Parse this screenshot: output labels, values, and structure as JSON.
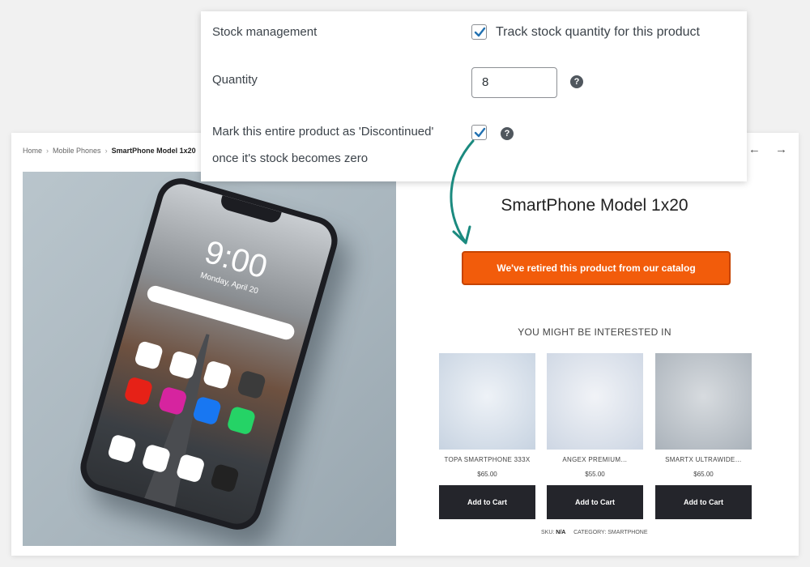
{
  "settings": {
    "stock_management_label": "Stock management",
    "track_stock_label": "Track stock quantity for this product",
    "track_stock_checked": true,
    "quantity_label": "Quantity",
    "quantity_value": "8",
    "discontinued_label_line1": "Mark this entire product as 'Discontinued'",
    "discontinued_label_line2": "once it's stock becomes zero",
    "discontinued_checked": true,
    "help_glyph": "?"
  },
  "breadcrumb": {
    "items": [
      "Home",
      "Mobile Phones"
    ],
    "current": "SmartPhone Model 1x20",
    "separator": "›"
  },
  "nav": {
    "prev": "←",
    "next": "→"
  },
  "phone_screen": {
    "time": "9:00",
    "date": "Monday, April 20"
  },
  "product": {
    "title": "SmartPhone Model 1x20",
    "retired_message": "We've retired this product from our catalog"
  },
  "related": {
    "heading": "YOU MIGHT BE INTERESTED IN",
    "items": [
      {
        "name": "TOPA SMARTPHONE 333X",
        "price": "$65.00",
        "button": "Add to Cart"
      },
      {
        "name": "ANGEX PREMIUM…",
        "price": "$55.00",
        "button": "Add to Cart"
      },
      {
        "name": "SMARTX ULTRAWIDE…",
        "price": "$65.00",
        "button": "Add to Cart"
      }
    ]
  },
  "meta": {
    "sku_label": "SKU:",
    "sku_value": "N/A",
    "category_label": "CATEGORY:",
    "category_value": "SMARTPHONE"
  },
  "colors": {
    "accent_orange": "#f25c0b",
    "checkbox_check": "#2271b1",
    "arrow_teal": "#1b8a7f",
    "button_dark": "#24252b"
  }
}
